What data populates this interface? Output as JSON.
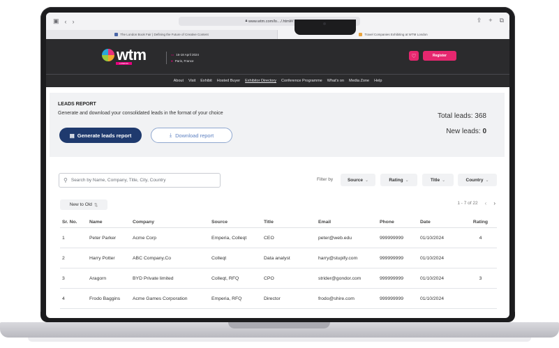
{
  "browser": {
    "url": "www.wtm.com/lo…/.html#/",
    "tabs": [
      {
        "title": "The London Book Fair | Defining the Future of Creative Content"
      },
      {
        "title": "Travel Companies Exhibiting at WTM London"
      }
    ]
  },
  "header": {
    "logo_text": "wtm",
    "logo_sub": "LONDON",
    "event_dates": "16-18 April 2024",
    "event_location": "Paris, France",
    "register_label": "Register"
  },
  "nav": {
    "items": [
      "About",
      "Visit",
      "Exhibit",
      "Hosted Buyer",
      "Exhibitor Directory",
      "Conference Programme",
      "What's on",
      "Media Zone",
      "Help"
    ]
  },
  "leads": {
    "title": "LEADS REPORT",
    "description": "Generate and download your consolidated leads in the format of your choice",
    "generate_label": "Generate leads report",
    "download_label": "Download report",
    "total_label": "Total leads: 368",
    "new_label": "New leads:",
    "new_value": "0"
  },
  "filters": {
    "search_placeholder": "Search by Name, Company, Title, City, Country",
    "filter_by_label": "Filter by",
    "source": "Source",
    "rating": "Rating",
    "title": "Title",
    "country": "Country",
    "sort_label": "New to Old",
    "pagination": "1 - 7 of 22"
  },
  "table": {
    "headers": [
      "Sr. No.",
      "Name",
      "Company",
      "Source",
      "Title",
      "Email",
      "Phone",
      "Date",
      "Rating"
    ],
    "rows": [
      [
        "1",
        "Peter Parker",
        "Acme Corp",
        "Emperia, Colleqt",
        "CEO",
        "peter@web.edu",
        "999999999",
        "01/10/2024",
        "4"
      ],
      [
        "2",
        "Harry Potter",
        "ABC Company.Co",
        "Colleqt",
        "Data analyst",
        "harry@stupify.com",
        "999999999",
        "01/10/2024",
        ""
      ],
      [
        "3",
        "Aragorn",
        "BYD Private limited",
        "Colleqt, RFQ",
        "CPO",
        "strider@gondor.com",
        "999999999",
        "01/10/2024",
        "3"
      ],
      [
        "4",
        "Frodo Baggins",
        "Acme Games Corporation",
        "Emperia, RFQ",
        "Director",
        "frodo@shire.com",
        "999999999",
        "01/10/2024",
        ""
      ]
    ]
  },
  "colors": {
    "accent_navy": "#1f3a6e",
    "brand_pink": "#e6276f",
    "header_dark": "#2b2b2d"
  }
}
